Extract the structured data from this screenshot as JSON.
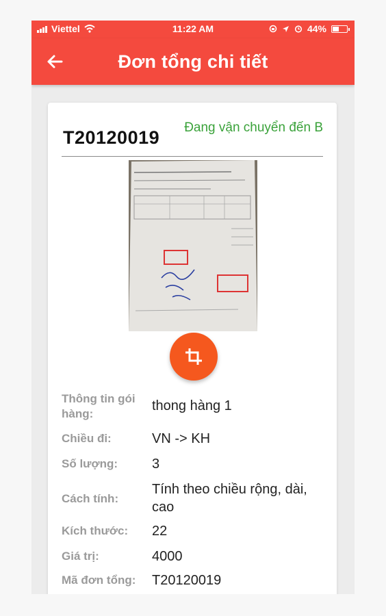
{
  "status_bar": {
    "carrier": "Viettel",
    "time": "11:22 AM",
    "battery": "44%",
    "battery_level": 0.44
  },
  "app_bar": {
    "title": "Đơn tổng chi tiết",
    "back_icon": "arrow-left-icon"
  },
  "order": {
    "code": "T20120019",
    "status": "Đang vận chuyển đến B",
    "status_color": "#3aa23a"
  },
  "photo": {
    "crop_icon": "crop-icon"
  },
  "details": [
    {
      "label": "Thông tin gói hàng:",
      "value": "thong hàng 1"
    },
    {
      "label": "Chiều đi:",
      "value": "VN -> KH"
    },
    {
      "label": "Số lượng:",
      "value": "3"
    },
    {
      "label": "Cách tính:",
      "value": "Tính theo chiều rộng, dài, cao"
    },
    {
      "label": "Kích thước:",
      "value": "22"
    },
    {
      "label": "Giá trị:",
      "value": "4000"
    },
    {
      "label": "Mã đơn tổng:",
      "value": "T20120019"
    }
  ],
  "colors": {
    "accent": "#f44a3e",
    "fab": "#f5581e",
    "label": "#9a9a9a"
  }
}
